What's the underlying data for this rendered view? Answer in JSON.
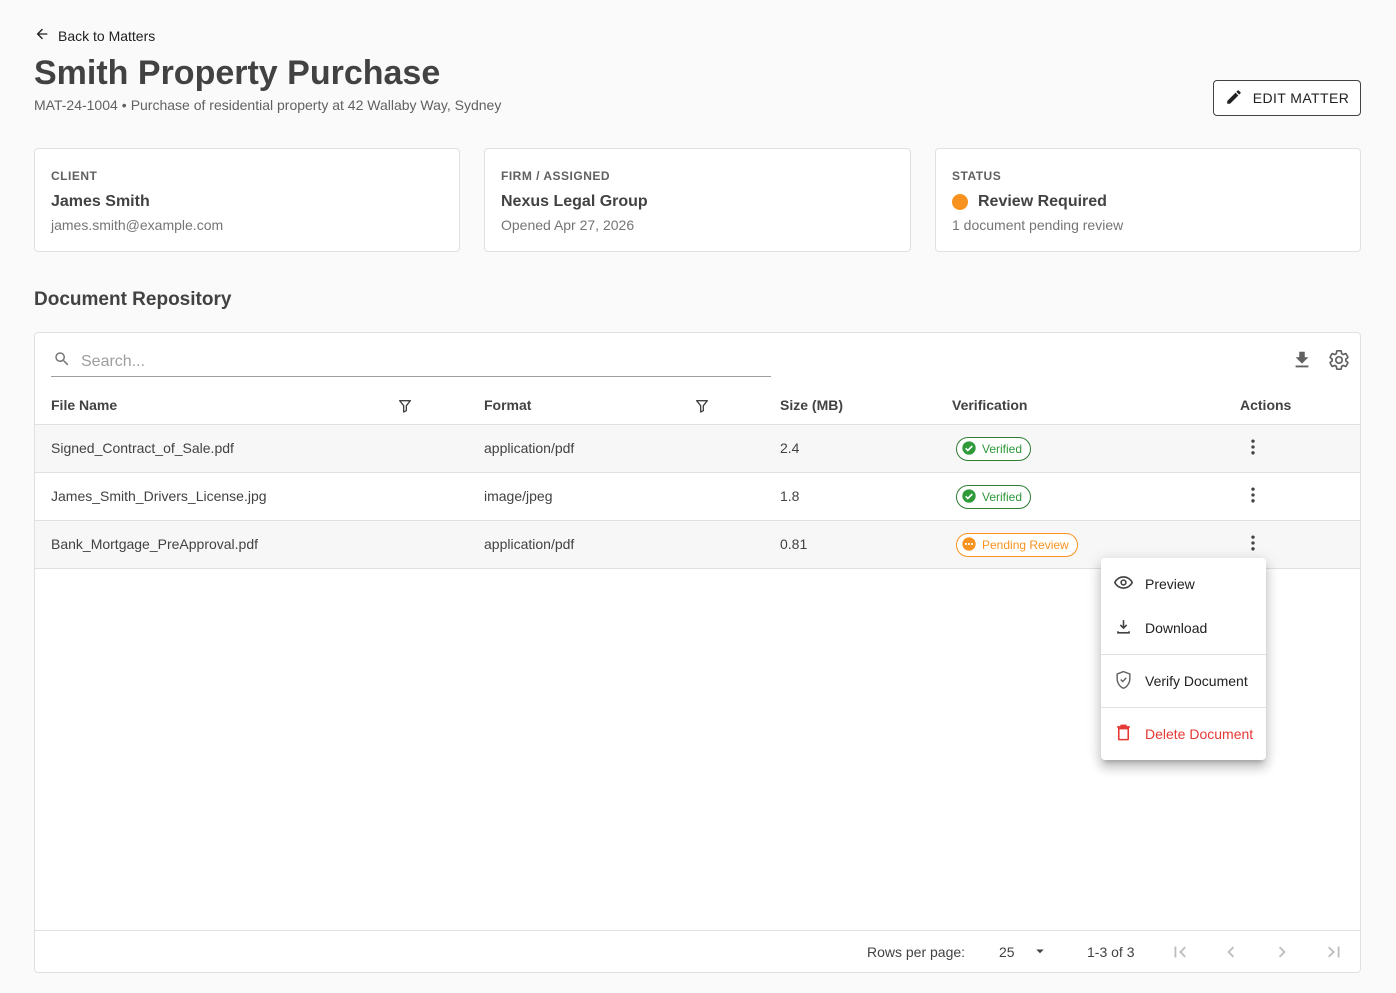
{
  "nav": {
    "back_label": "Back to Matters"
  },
  "matter": {
    "title": "Smith Property Purchase",
    "id": "MAT-24-1004",
    "separator": "•",
    "description": "Purchase of residential property at 42 Wallaby Way, Sydney",
    "edit_label": "EDIT MATTER"
  },
  "cards": {
    "client": {
      "label": "CLIENT",
      "name": "James Smith",
      "sub": "james.smith@example.com"
    },
    "firm": {
      "label": "FIRM / ASSIGNED",
      "name": "Nexus Legal Group",
      "sub": "Opened Apr 27, 2026"
    },
    "status": {
      "label": "STATUS",
      "name": "Review Required",
      "sub": "1 document pending review",
      "color": "#f7931e"
    }
  },
  "repository": {
    "title": "Document Repository",
    "search_placeholder": "Search...",
    "columns": {
      "file_name": "File Name",
      "format": "Format",
      "size": "Size (MB)",
      "verification": "Verification",
      "actions": "Actions"
    },
    "rows": [
      {
        "file_name": "Signed_Contract_of_Sale.pdf",
        "format": "application/pdf",
        "size": "2.4",
        "verification": "Verified"
      },
      {
        "file_name": "James_Smith_Drivers_License.jpg",
        "format": "image/jpeg",
        "size": "1.8",
        "verification": "Verified"
      },
      {
        "file_name": "Bank_Mortgage_PreApproval.pdf",
        "format": "application/pdf",
        "size": "0.81",
        "verification": "Pending Review"
      }
    ],
    "footer": {
      "rows_per_page_label": "Rows per page:",
      "rows_per_page_value": "25",
      "range": "1-3 of 3"
    }
  },
  "context_menu": {
    "preview": "Preview",
    "download": "Download",
    "verify": "Verify Document",
    "delete": "Delete Document"
  },
  "colors": {
    "verified": "#2e9a3a",
    "pending": "#f7931e",
    "danger": "#e53935"
  }
}
